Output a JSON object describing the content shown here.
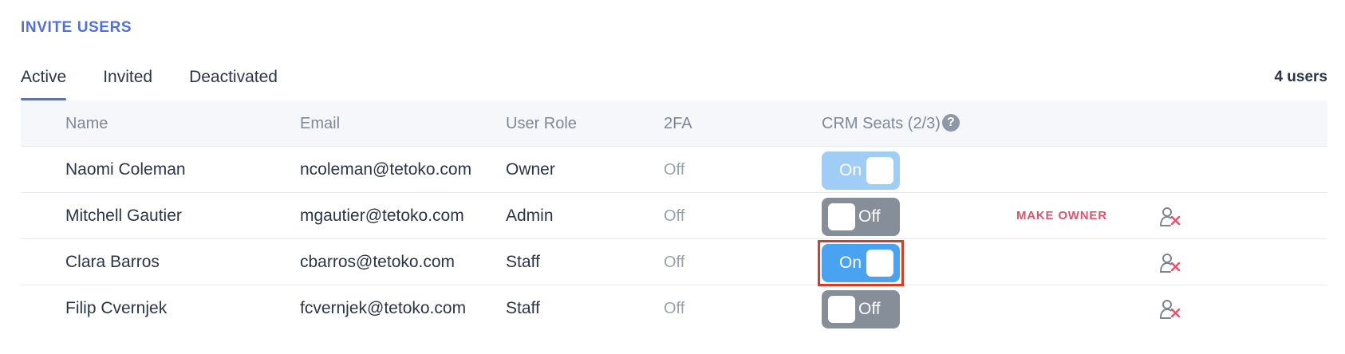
{
  "section": {
    "title": "INVITE USERS"
  },
  "tabs": [
    {
      "label": "Active",
      "active": true
    },
    {
      "label": "Invited",
      "active": false
    },
    {
      "label": "Deactivated",
      "active": false
    }
  ],
  "user_count": "4 users",
  "table": {
    "headers": {
      "name": "Name",
      "email": "Email",
      "role": "User Role",
      "twofa": "2FA",
      "seats": "CRM Seats (2/3)"
    },
    "help_icon_glyph": "?",
    "make_owner_label": "MAKE OWNER",
    "rows": [
      {
        "name": "Naomi Coleman",
        "email": "ncoleman@tetoko.com",
        "role": "Owner",
        "twofa": "Off",
        "seat": "On"
      },
      {
        "name": "Mitchell Gautier",
        "email": "mgautier@tetoko.com",
        "role": "Admin",
        "twofa": "Off",
        "seat": "Off"
      },
      {
        "name": "Clara Barros",
        "email": "cbarros@tetoko.com",
        "role": "Staff",
        "twofa": "Off",
        "seat": "On"
      },
      {
        "name": "Filip Cvernjek",
        "email": "fcvernjek@tetoko.com",
        "role": "Staff",
        "twofa": "Off",
        "seat": "Off"
      }
    ]
  },
  "colors": {
    "accent": "#4f6fe6",
    "toggle_on": "#4aa3f0",
    "toggle_on_disabled": "#9fcdf6",
    "toggle_off": "#858e99",
    "danger": "#e8506b",
    "highlight": "#e0391f"
  },
  "icons": {
    "help": "question-circle-icon",
    "remove_user": "user-remove-icon"
  }
}
